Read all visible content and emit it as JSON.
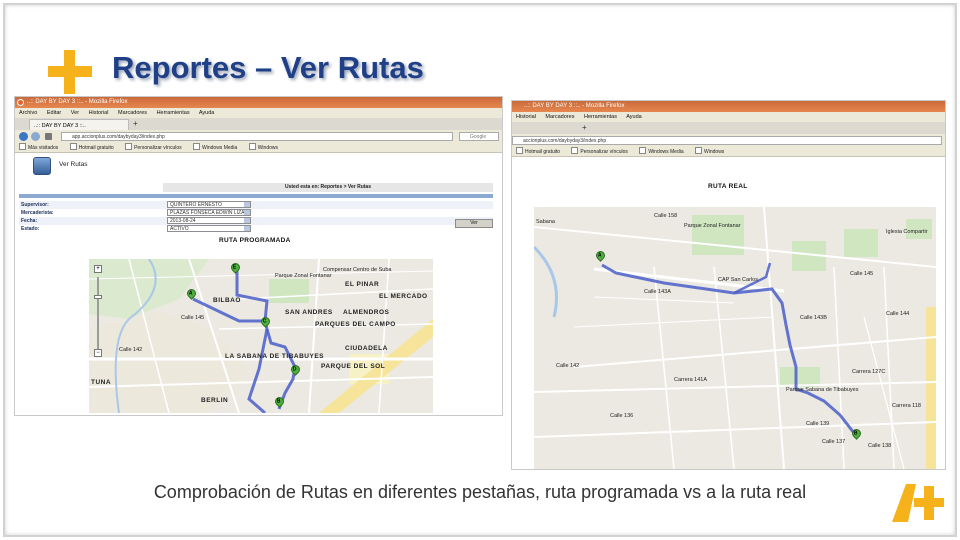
{
  "slide": {
    "title": "Reportes – Ver Rutas",
    "caption": "Comprobación de Rutas en diferentes pestañas, ruta programada vs a la ruta real",
    "accent": "#f6b21b",
    "title_color": "#1f3f87"
  },
  "left_shot": {
    "window_title": "..:: DAY BY DAY 3 ::.. - Mozilla Firefox",
    "menu": [
      "Archivo",
      "Editar",
      "Ver",
      "Historial",
      "Marcadores",
      "Herramientas",
      "Ayuda"
    ],
    "tab_label": "..:: DAY BY DAY 3 ::..",
    "new_tab": "+",
    "url": "app.accionplus.com/daybyday3/index.php",
    "search_placeholder": "Google",
    "bookmarks": [
      "Más visitados",
      "Hotmail gratuito",
      "Personalizar vínculos",
      "Windows Media",
      "Windows"
    ],
    "page_title": "Ver Rutas",
    "breadcrumb": "Usted esta en: Reportes > Ver Rutas",
    "form": [
      {
        "label": "Supervisor:",
        "value": "QUINTERO ERNESTO"
      },
      {
        "label": "Mercaderista:",
        "value": "PLAZAS FONSECA EDWIN LIZARDO"
      },
      {
        "label": "Fecha:",
        "value": "2013-08-24"
      },
      {
        "label": "Estado:",
        "value": "ACTIVO"
      }
    ],
    "button": "Ver",
    "route_label": "RUTA PROGRAMADA",
    "map_labels": {
      "bilbao": "BILBAO",
      "parque_zonal": "Parque Zonal Fontanar",
      "compensar": "Compensar Centro de Suba",
      "el_pinar": "EL PINAR",
      "el_mercado": "EL MERCADO",
      "almendros": "ALMENDROS",
      "san_andres": "SAN ANDRES",
      "parques_del_campo": "PARQUES DEL CAMPO",
      "ciudadela": "CIUDADELA",
      "la_sabana": "LA SABANA DE TIBABUYES",
      "parque_del_sol": "PARQUE DEL SOL",
      "tuna": "TUNA",
      "berlin": "BERLIN",
      "calle142": "Calle 142",
      "calle145": "Calle 145"
    },
    "pins": [
      "A",
      "B",
      "C",
      "D",
      "E"
    ]
  },
  "right_shot": {
    "window_title": "..:: DAY BY DAY 3 ::.. - Mozilla Firefox",
    "menu": [
      "Historial",
      "Marcadores",
      "Herramientas",
      "Ayuda"
    ],
    "new_tab": "+",
    "url": "accionplus.com/daybyday3/index.php",
    "bookmarks": [
      "Hotmail gratuito",
      "Personalizar vínculos",
      "Windows Media",
      "Windows"
    ],
    "route_label": "RUTA REAL",
    "map_labels": {
      "calle158": "Calle 158",
      "parque_zonal": "Parque Zonal Fontanar",
      "iglesia": "Iglesia Compartir",
      "calle145": "Calle 145",
      "calle144": "Calle 144",
      "calle143a": "Calle 143A",
      "calle143b": "Calle 143B",
      "calle142": "Calle 142",
      "calle139": "Calle 139",
      "calle137": "Calle 137",
      "calle136": "Calle 136",
      "calle138": "Calle 138",
      "carrera141a": "Carrera 141A",
      "carrera127c": "Carrera 127C",
      "carrera118": "Carrera 118",
      "parque_sabana": "Parque Sabana de Tibabuyes",
      "cap": "CAP San Carlos",
      "sabana": "Sabana"
    },
    "pins": [
      "A",
      "B"
    ]
  }
}
